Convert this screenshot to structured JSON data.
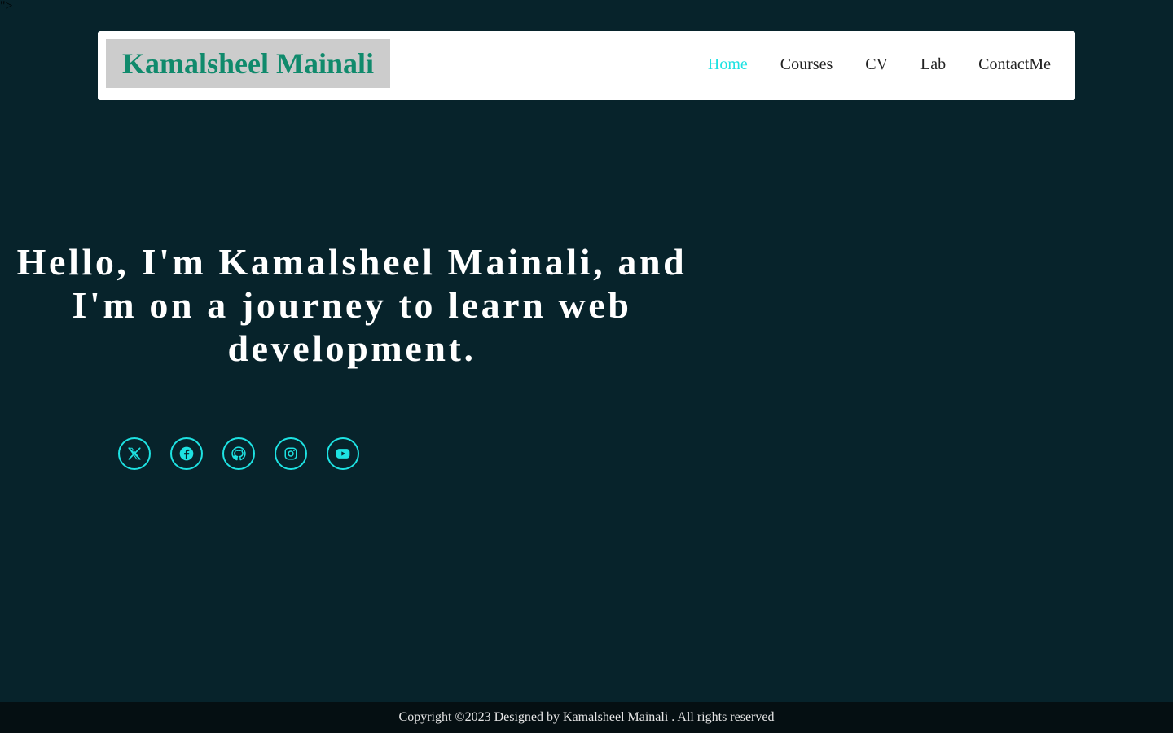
{
  "stray_text": "\">",
  "brand": {
    "name": "Kamalsheel Mainali"
  },
  "nav": {
    "items": [
      {
        "label": "Home",
        "active": true
      },
      {
        "label": "Courses",
        "active": false
      },
      {
        "label": "CV",
        "active": false
      },
      {
        "label": "Lab",
        "active": false
      },
      {
        "label": "ContactMe",
        "active": false
      }
    ]
  },
  "hero": {
    "title": "Hello, I'm Kamalsheel Mainali, and I'm on a journey to learn web development."
  },
  "socials": [
    {
      "icon": "x-twitter-icon"
    },
    {
      "icon": "facebook-icon"
    },
    {
      "icon": "github-icon"
    },
    {
      "icon": "instagram-icon"
    },
    {
      "icon": "youtube-icon"
    }
  ],
  "footer": {
    "text": "Copyright ©2023 Designed by Kamalsheel Mainali . All rights reserved"
  },
  "colors": {
    "background": "#07232b",
    "accent": "#1ee2e2",
    "brand": "#108a6c",
    "footer_bg": "#050f12"
  }
}
